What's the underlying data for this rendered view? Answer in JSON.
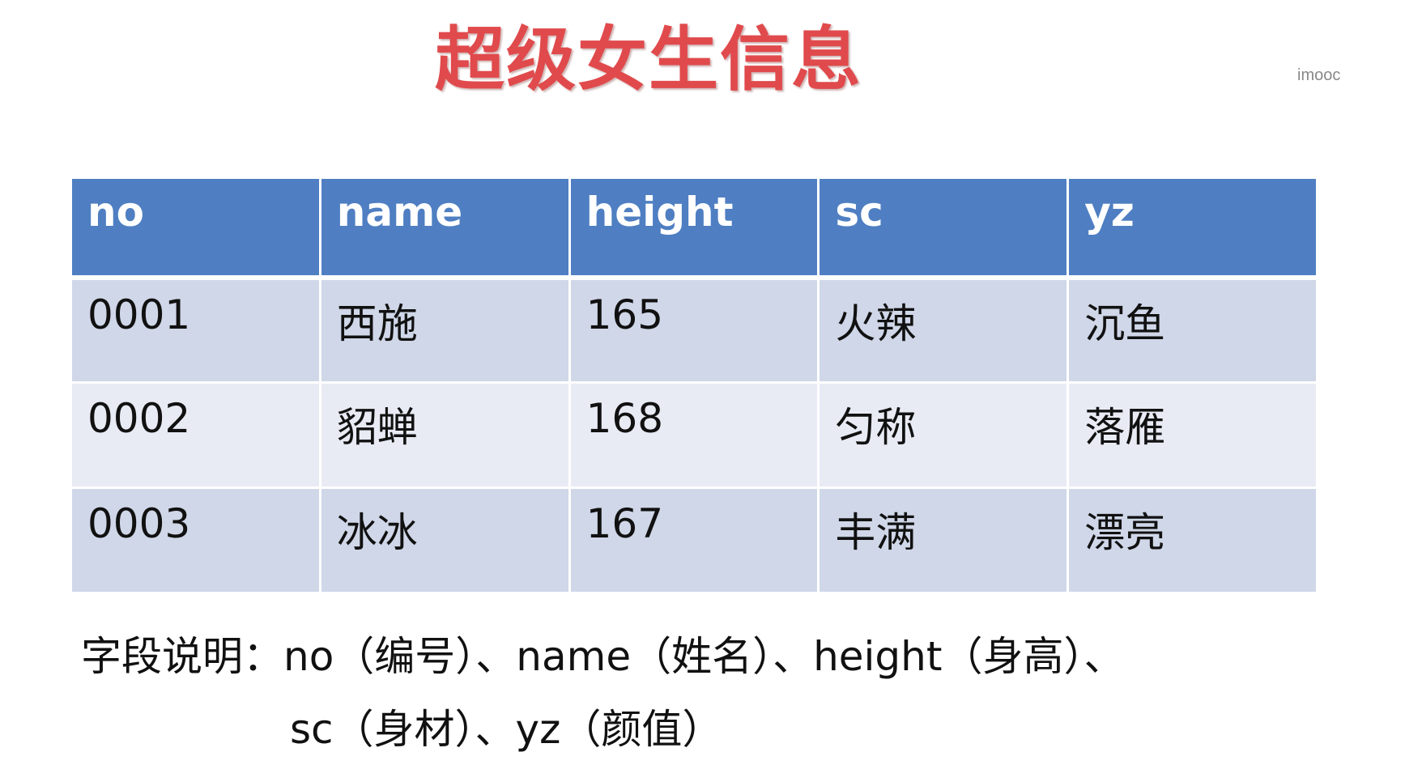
{
  "title": "超级女生信息",
  "watermark": "imooc",
  "table": {
    "headers": [
      "no",
      "name",
      "height",
      "sc",
      "yz"
    ],
    "rows": [
      [
        "0001",
        "西施",
        "165",
        "火辣",
        "沉鱼"
      ],
      [
        "0002",
        "貂蝉",
        "168",
        "匀称",
        "落雁"
      ],
      [
        "0003",
        "冰冰",
        "167",
        "丰满",
        "漂亮"
      ]
    ]
  },
  "note": {
    "line1": "字段说明：no（编号）、name（姓名）、height（身高）、",
    "line2": "sc（身材）、yz（颜值）"
  },
  "colors": {
    "title": "#e04a4c",
    "header_bg": "#4f7fc2",
    "row_odd_bg": "#cfd7e8",
    "row_even_bg": "#e8ebf4"
  }
}
